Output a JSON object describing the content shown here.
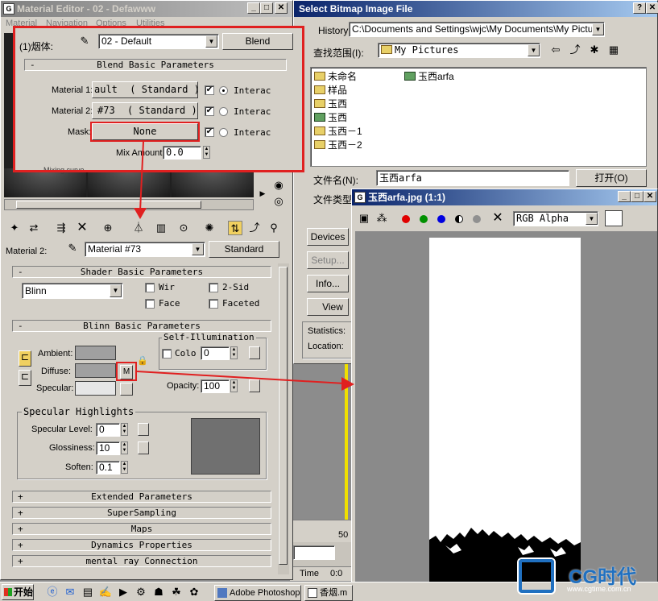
{
  "mat_editor": {
    "title": "Material Editor - 02 - Defawww",
    "menu": [
      "Material",
      "Navigation",
      "Options",
      "Utilities"
    ],
    "blend_name_label": "(1)烟体:",
    "blend_material_value": "02 - Default",
    "blend_type_button": "Blend",
    "blend_rollout_title": "Blend Basic Parameters",
    "material1_label": "Material 1:",
    "material1_value": "ault",
    "material1_type": "( Standard )",
    "material2_label": "Material 2:",
    "material2_value": "#73",
    "material2_type": "( Standard )",
    "mask_label": "Mask:",
    "mask_value": "None",
    "interactive_label": "Interac",
    "mix_amount_label": "Mix Amount:",
    "mix_amount_value": "0.0",
    "hidden_rollout_partial": "Mixing curve",
    "sub_material_label": "Material 2:",
    "sub_material_value": "Material #73",
    "sub_material_type": "Standard",
    "shader_rollout_title": "Shader Basic Parameters",
    "shader_value": "Blinn",
    "wire_label": "Wir",
    "two_sided_label": "2-Sid",
    "face_label": "Face",
    "faceted_label": "Faceted",
    "blinn_rollout_title": "Blinn Basic Parameters",
    "self_illum_title": "Self-Illumination",
    "color_label": "Colo",
    "color_value": "0",
    "ambient_label": "Ambient:",
    "diffuse_label": "Diffuse:",
    "specular_label": "Specular:",
    "diffuse_map_button": "M",
    "opacity_label": "Opacity:",
    "opacity_value": "100",
    "spec_highlights_title": "Specular Highlights",
    "spec_level_label": "Specular Level:",
    "spec_level_value": "0",
    "glossiness_label": "Glossiness:",
    "glossiness_value": "10",
    "soften_label": "Soften:",
    "soften_value": "0.1",
    "collapsed_rollouts": [
      "Extended Parameters",
      "SuperSampling",
      "Maps",
      "Dynamics Properties",
      "mental ray Connection"
    ],
    "rollout_plus": "+",
    "rollout_minus": "-"
  },
  "bitmap_dialog": {
    "title": "Select Bitmap Image File",
    "history_label": "History:",
    "history_value": "C:\\Documents and Settings\\wjc\\My Documents\\My Pictures",
    "lookin_label": "查找范围(I):",
    "lookin_value": "My Pictures",
    "files": [
      {
        "name": "未命名",
        "type": "folder"
      },
      {
        "name": "玉西arfa",
        "type": "image"
      },
      {
        "name": "样品",
        "type": "folder"
      },
      {
        "name": "玉西",
        "type": "folder"
      },
      {
        "name": "玉西",
        "type": "image"
      },
      {
        "name": "玉西－1",
        "type": "folder"
      },
      {
        "name": "玉西－2",
        "type": "folder"
      }
    ],
    "filename_label": "文件名(N):",
    "filename_value": "玉西arfa",
    "filetype_label": "文件类型",
    "open_button": "打开(O)",
    "devices_button": "Devices",
    "setup_button": "Setup...",
    "info_button": "Info...",
    "view_button": "View",
    "statistics_label": "Statistics:",
    "location_label": "Location:"
  },
  "image_viewer": {
    "title": "玉西arfa.jpg (1:1)",
    "channel_value": "RGB Alpha"
  },
  "viewport": {
    "ruler_value": "50",
    "time_label": "Time",
    "time_value": "0:0"
  },
  "taskbar": {
    "start_label": "开始",
    "tasks": [
      "Adobe Photoshop",
      "香烟.m"
    ]
  },
  "watermark": {
    "brand": "CG时代",
    "url": "www.cgtime.com.cn"
  },
  "colors": {
    "highlight_red": "#e02020",
    "title_blue": "#0a246a",
    "face_gray": "#d4d0c8"
  }
}
